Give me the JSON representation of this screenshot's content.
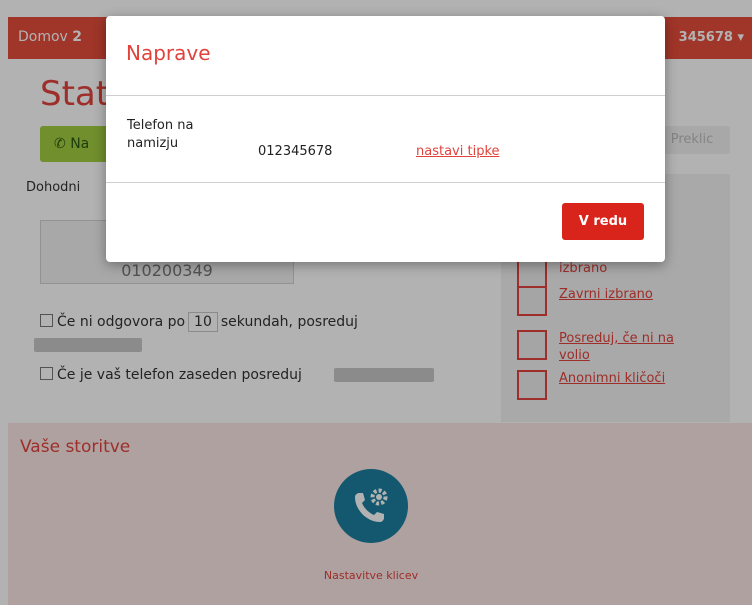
{
  "topbar": {
    "home_label": "Domov",
    "home_suffix": "2",
    "account_number": "345678",
    "caret": "▾"
  },
  "page": {
    "title": "Stat",
    "green_button_label": "Na",
    "cancel_label": "Preklic",
    "incoming_label": "Dohodni",
    "forward_number": "010200349"
  },
  "options": {
    "no_answer_prefix": "Če ni odgovora po",
    "no_answer_seconds": "10",
    "no_answer_suffix": "sekundah, posreduj",
    "busy_text": "Če je vaš telefon zaseden posreduj"
  },
  "right_panel": {
    "items": [
      {
        "label": "izbrano",
        "link": false
      },
      {
        "label": "Zavrni izbrano",
        "link": true
      },
      {
        "label": "Posreduj, če ni na volio",
        "link": true
      },
      {
        "label": "Anonimni kličoči",
        "link": true
      }
    ]
  },
  "services": {
    "title": "Vaše storitve",
    "settings_label": "Nastavitve klicev"
  },
  "modal": {
    "title": "Naprave",
    "device_label": "Telefon na namizju",
    "device_number": "012345678",
    "set_keys_link": "nastavi tipke",
    "ok_label": "V redu"
  },
  "colors": {
    "brand_red": "#e64c3c",
    "green": "#a2cd3f",
    "service_blue": "#1c7fa0"
  }
}
